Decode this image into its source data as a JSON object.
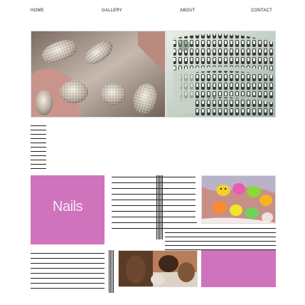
{
  "nav": {
    "home": "HOME",
    "gallery": "GALLERY",
    "about": "ABOUT",
    "contact": "CONTACT"
  },
  "hero": {
    "title": "Nails"
  },
  "colors": {
    "accent_pink": "#d073bd",
    "line": "#222222"
  },
  "images": {
    "glitter_nails": "glitter-nails-photo",
    "salon_rack": "nail-polish-rack-photo",
    "smiley_nails": "smiley-nails-photo",
    "brown_nails": "brown-nails-photo"
  }
}
